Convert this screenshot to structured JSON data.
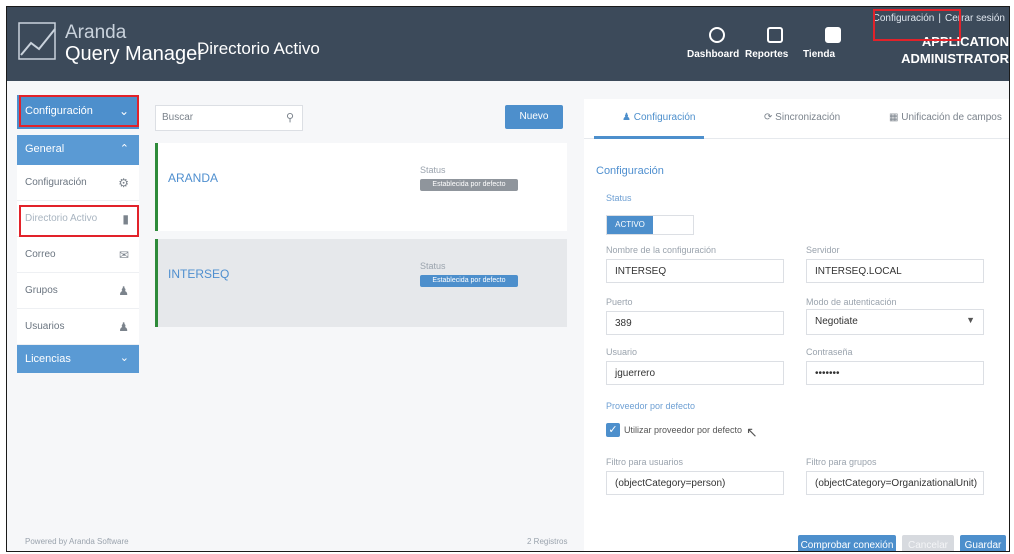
{
  "header": {
    "brand_small": "Aranda",
    "brand_large": "Query Manager",
    "page_title": "Directorio Activo",
    "nav": [
      {
        "label": "Dashboard",
        "icon": "pie-chart-icon"
      },
      {
        "label": "Reportes",
        "icon": "report-icon"
      },
      {
        "label": "Tienda",
        "icon": "store-icon"
      }
    ],
    "top_links": {
      "config": "Configuración",
      "logout": "Cerrar sesión"
    },
    "user_line1": "APPLICATION",
    "user_line2": "ADMINISTRATOR"
  },
  "sidebar": {
    "config_label": "Configuración",
    "general_label": "General",
    "items": [
      {
        "label": "Configuración",
        "icon": "gear-icon"
      },
      {
        "label": "Directorio Activo",
        "icon": "document-icon"
      },
      {
        "label": "Correo",
        "icon": "mail-icon"
      },
      {
        "label": "Grupos",
        "icon": "group-icon"
      },
      {
        "label": "Usuarios",
        "icon": "user-icon"
      }
    ],
    "licencias_label": "Licencias",
    "footer": "Powered by Aranda Software"
  },
  "list": {
    "search_placeholder": "Buscar",
    "new_button": "Nuevo",
    "entries": [
      {
        "name": "ARANDA",
        "status_label": "Status",
        "badge": "Establecida por defecto",
        "badge_color": "#8f959c"
      },
      {
        "name": "INTERSEQ",
        "status_label": "Status",
        "badge": "Establecida por defecto",
        "badge_color": "#4d8fcc"
      }
    ],
    "footer": "2 Registros"
  },
  "panel": {
    "tabs": [
      {
        "label": "Configuración",
        "icon": "gear-icon"
      },
      {
        "label": "Sincronización",
        "icon": "sync-icon"
      },
      {
        "label": "Unificación de campos",
        "icon": "grid-icon"
      }
    ],
    "section_title": "Configuración",
    "status_label": "Status",
    "toggle_label": "ACTIVO",
    "name_label": "Nombre de la configuración",
    "name_value": "INTERSEQ",
    "server_label": "Servidor",
    "server_value": "INTERSEQ.LOCAL",
    "port_label": "Puerto",
    "port_value": "389",
    "auth_label": "Modo de autenticación",
    "auth_value": "Negotiate",
    "user_label": "Usuario",
    "user_value": "jguerrero",
    "password_label": "Contraseña",
    "password_value": "•••••••",
    "provider_label": "Proveedor por defecto",
    "provider_checkbox": "Utilizar proveedor por defecto",
    "filter_users_label": "Filtro para usuarios",
    "filter_users_value": "(objectCategory=person)",
    "filter_groups_label": "Filtro para grupos",
    "filter_groups_value": "(objectCategory=OrganizationalUnit)",
    "buttons": {
      "test": "Comprobar conexión",
      "cancel": "Cancelar",
      "save": "Guardar"
    }
  },
  "colors": {
    "accent": "#4d8fcc",
    "header": "#3c4a5a",
    "highlight": "#e2222a",
    "active_bar": "#2e8b3a"
  }
}
